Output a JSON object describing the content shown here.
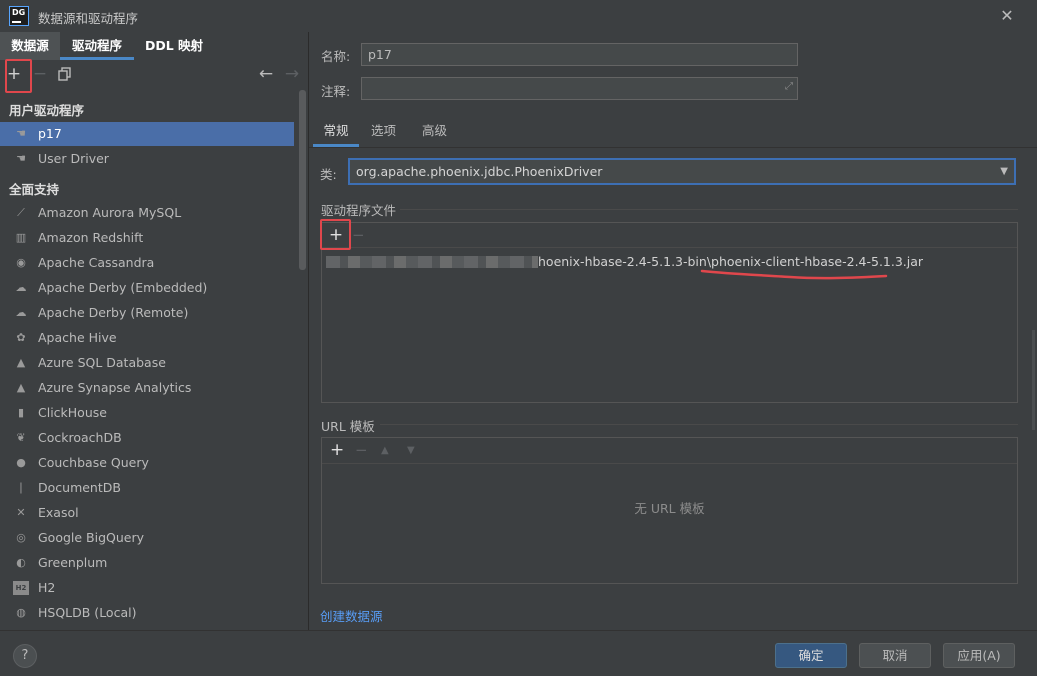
{
  "window": {
    "logo_text": "DG",
    "title": "数据源和驱动程序"
  },
  "left": {
    "tabs": [
      "数据源",
      "驱动程序",
      "DDL 映射"
    ],
    "toolbar": {
      "add": "+",
      "remove": "−",
      "back": "←",
      "forward": "→"
    },
    "user_section": "用户驱动程序",
    "user_drivers": [
      {
        "label": "p17",
        "icon": "driver-icon",
        "selected": true
      },
      {
        "label": "User Driver",
        "icon": "driver-icon"
      }
    ],
    "full_section": "全面支持",
    "drivers": [
      {
        "label": "Amazon Aurora MySQL",
        "icon": "aurora-icon"
      },
      {
        "label": "Amazon Redshift",
        "icon": "redshift-icon"
      },
      {
        "label": "Apache Cassandra",
        "icon": "cassandra-icon"
      },
      {
        "label": "Apache Derby (Embedded)",
        "icon": "derby-icon"
      },
      {
        "label": "Apache Derby (Remote)",
        "icon": "derby-icon"
      },
      {
        "label": "Apache Hive",
        "icon": "hive-icon"
      },
      {
        "label": "Azure SQL Database",
        "icon": "azure-icon"
      },
      {
        "label": "Azure Synapse Analytics",
        "icon": "azure-icon"
      },
      {
        "label": "ClickHouse",
        "icon": "clickhouse-icon"
      },
      {
        "label": "CockroachDB",
        "icon": "cockroach-icon"
      },
      {
        "label": "Couchbase Query",
        "icon": "couchbase-icon"
      },
      {
        "label": "DocumentDB",
        "icon": "documentdb-icon"
      },
      {
        "label": "Exasol",
        "icon": "exasol-icon"
      },
      {
        "label": "Google BigQuery",
        "icon": "bigquery-icon"
      },
      {
        "label": "Greenplum",
        "icon": "greenplum-icon"
      },
      {
        "label": "H2",
        "icon": "h2-icon"
      },
      {
        "label": "HSQLDB (Local)",
        "icon": "hsqldb-icon"
      }
    ]
  },
  "right": {
    "name_label": "名称:",
    "name_value": "p17",
    "comment_label": "注释:",
    "comment_value": "",
    "tabs": [
      "常规",
      "选项",
      "高级"
    ],
    "class_label": "类:",
    "class_value": "org.apache.phoenix.jdbc.PhoenixDriver",
    "files_title": "驱动程序文件",
    "files_toolbar": {
      "add": "+",
      "remove": "−"
    },
    "file_path": "hoenix-hbase-2.4-5.1.3-bin\\phoenix-client-hbase-2.4-5.1.3.jar",
    "url_title": "URL 模板",
    "url_toolbar": {
      "add": "+",
      "remove": "−",
      "up": "▲",
      "down": "▼"
    },
    "url_empty": "无 URL 模板",
    "create_link": "创建数据源"
  },
  "footer": {
    "help": "?",
    "ok": "确定",
    "cancel": "取消",
    "apply": "应用(A)"
  },
  "colors": {
    "accent": "#4a88c7",
    "selected": "#4a6ea8",
    "highlight": "#e0474c",
    "link": "#589df6"
  }
}
